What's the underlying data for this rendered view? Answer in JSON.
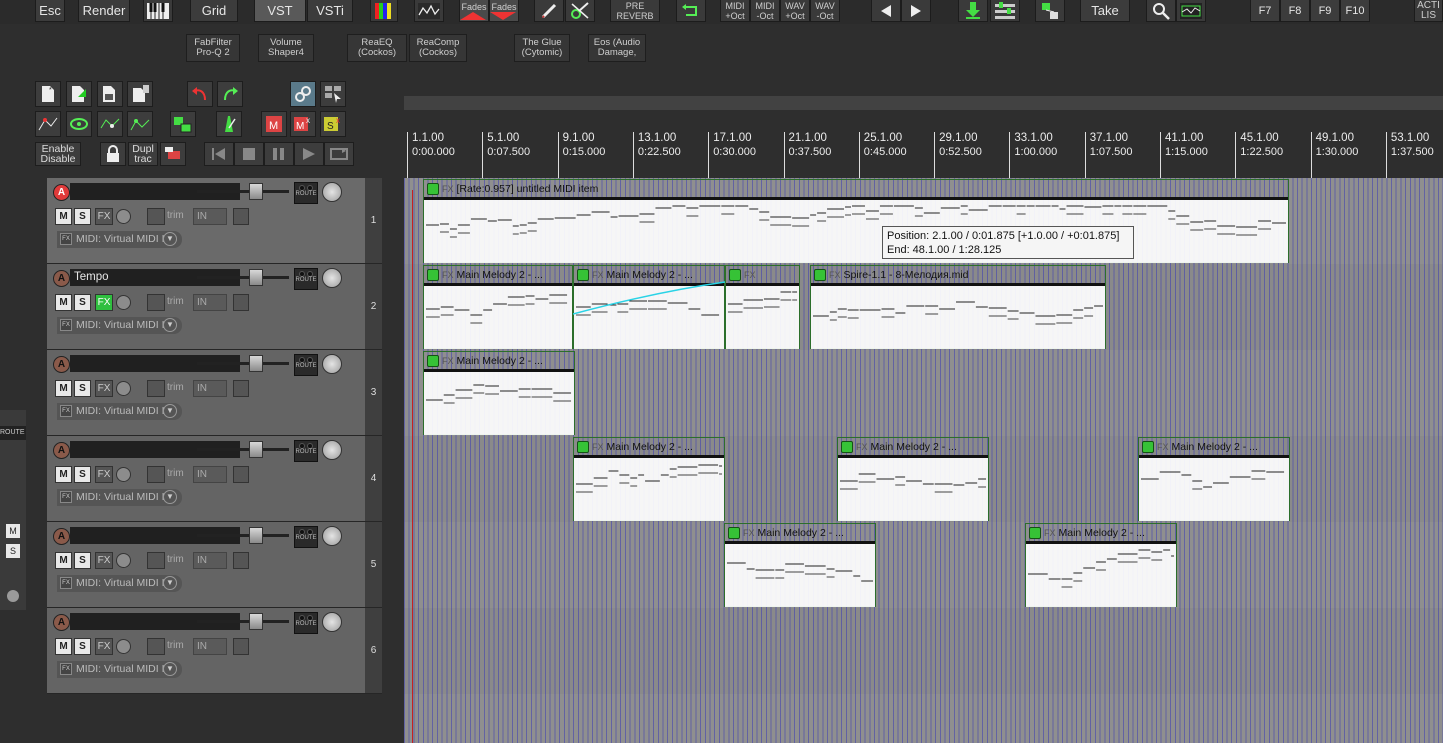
{
  "toolbar": {
    "buttons": {
      "esc": "Esc",
      "render": "Render",
      "grid": "Grid",
      "vst": "VST",
      "vsti": "VSTi",
      "fades1": "Fades",
      "fades2": "Fades",
      "pre_reverb_1": "PRE",
      "pre_reverb_2": "REVERB",
      "midi_plus_oct_1": "MIDI",
      "midi_plus_oct_2": "+Oct",
      "midi_minus_oct_1": "MIDI",
      "midi_minus_oct_2": "-Oct",
      "wav_plus_oct_1": "WAV",
      "wav_plus_oct_2": "+Oct",
      "wav_minus_oct_1": "WAV",
      "wav_minus_oct_2": "-Oct",
      "take": "Take",
      "f7": "F7",
      "f8": "F8",
      "f9": "F9",
      "f10": "F10",
      "actions_1": "ACTI",
      "actions_2": "LIS"
    }
  },
  "fxbar": {
    "items": [
      {
        "l1": "FabFilter",
        "l2": "Pro-Q 2"
      },
      {
        "l1": "Volume",
        "l2": "Shaper4"
      },
      {
        "l1": "ReaEQ",
        "l2": "(Cockos)"
      },
      {
        "l1": "ReaComp",
        "l2": "(Cockos)"
      },
      {
        "l1": "The Glue",
        "l2": "(Cytomic)"
      },
      {
        "l1": "Eos (Audio",
        "l2": "Damage,"
      }
    ]
  },
  "leftpanel": {
    "enable_disable_1": "Enable",
    "enable_disable_2": "Disable",
    "dupl_1": "Dupl",
    "dupl_2": "trac",
    "route_label": "ROUTE",
    "side_m": "M",
    "side_s": "S"
  },
  "tracks": [
    {
      "num": "1",
      "name": "",
      "midi": "MIDI: Virtual MIDI I",
      "fx_on": false,
      "armed": true
    },
    {
      "num": "2",
      "name": "Tempo",
      "midi": "MIDI: Virtual MIDI I",
      "fx_on": true,
      "armed": false
    },
    {
      "num": "3",
      "name": "",
      "midi": "MIDI: Virtual MIDI I",
      "fx_on": false,
      "armed": false
    },
    {
      "num": "4",
      "name": "",
      "midi": "MIDI: Virtual MIDI I",
      "fx_on": false,
      "armed": false
    },
    {
      "num": "5",
      "name": "",
      "midi": "MIDI: Virtual MIDI I",
      "fx_on": false,
      "armed": false
    },
    {
      "num": "6",
      "name": "",
      "midi": "MIDI: Virtual MIDI I",
      "fx_on": false,
      "armed": false
    }
  ],
  "track_controls": {
    "m": "M",
    "s": "S",
    "fx": "FX",
    "trim": "trim",
    "in": "IN",
    "rec": "A",
    "route": "ROUTE"
  },
  "ruler": [
    {
      "bar": "1.1.00",
      "time": "0:00.000"
    },
    {
      "bar": "5.1.00",
      "time": "0:07.500"
    },
    {
      "bar": "9.1.00",
      "time": "0:15.000"
    },
    {
      "bar": "13.1.00",
      "time": "0:22.500"
    },
    {
      "bar": "17.1.00",
      "time": "0:30.000"
    },
    {
      "bar": "21.1.00",
      "time": "0:37.500"
    },
    {
      "bar": "25.1.00",
      "time": "0:45.000"
    },
    {
      "bar": "29.1.00",
      "time": "0:52.500"
    },
    {
      "bar": "33.1.00",
      "time": "1:00.000"
    },
    {
      "bar": "37.1.00",
      "time": "1:07.500"
    },
    {
      "bar": "41.1.00",
      "time": "1:15.000"
    },
    {
      "bar": "45.1.00",
      "time": "1:22.500"
    },
    {
      "bar": "49.1.00",
      "time": "1:30.000"
    },
    {
      "bar": "53.1.00",
      "time": "1:37.500"
    }
  ],
  "items": {
    "i1": "[Rate:0.957] untitled MIDI item",
    "i2a": "Main Melody 2 - ...",
    "i2b": "Main Melody 2 - ...",
    "i2c": "",
    "i2d": "Spire-1.1 - 8-Мелодия.mid",
    "i3": "Main Melody 2 - ...",
    "i4a": "Main Melody 2 - ...",
    "i4b": "Main Melody 2 - ...",
    "i4c": "Main Melody 2 - ...",
    "i5a": "Main Melody 2 - ...",
    "i5b": "Main Melody 2 - ..."
  },
  "item_fx_label": "FX",
  "tooltip": {
    "line1": "Position: 2.1.00 / 0:01.875 [+1.0.00 / +0:01.875]",
    "line2": "End: 48.1.00 / 1:28.125"
  },
  "colors": {
    "item_green": "#36c236",
    "cursor_red": "#c62020",
    "fx_active": "#2fbf3f",
    "rec_armed": "#e03a3a"
  }
}
